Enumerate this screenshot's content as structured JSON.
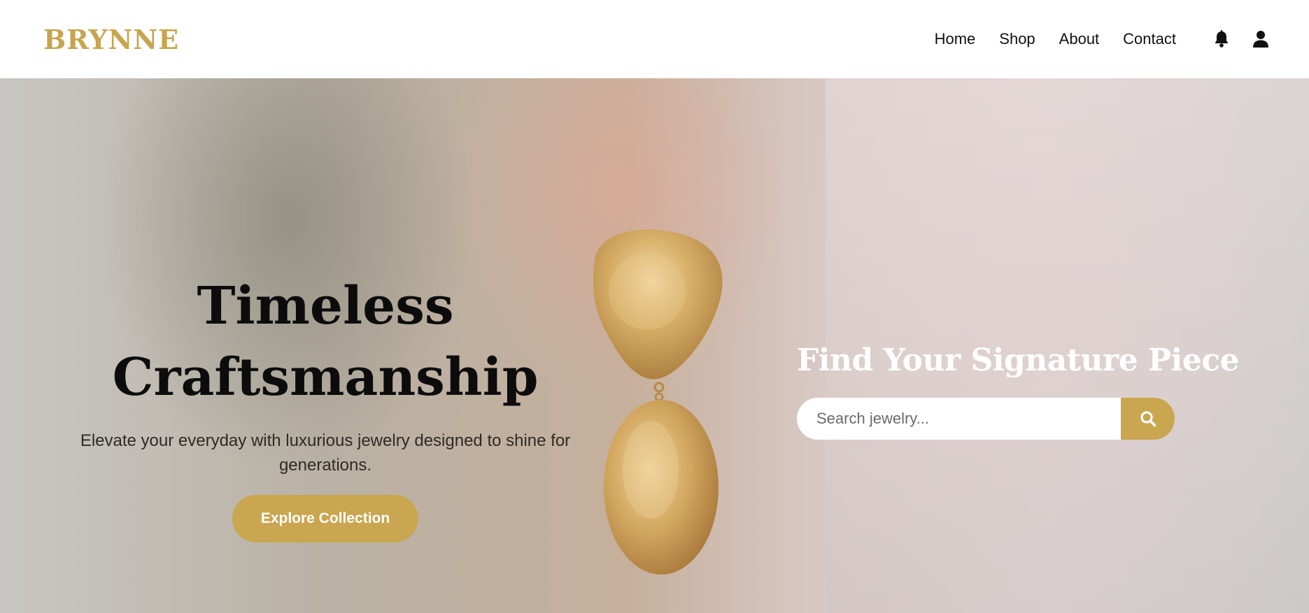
{
  "brand": {
    "logo": "BRYNNE",
    "accent_color": "#c9a64f"
  },
  "nav": {
    "items": [
      {
        "label": "Home"
      },
      {
        "label": "Shop"
      },
      {
        "label": "About"
      },
      {
        "label": "Contact"
      }
    ],
    "icons": [
      "bell-icon",
      "user-icon"
    ]
  },
  "hero": {
    "title_line1": "Timeless",
    "title_line2": "Craftsmanship",
    "subtitle": "Elevate your everyday with luxurious jewelry designed to shine for generations.",
    "cta_label": "Explore Collection"
  },
  "search": {
    "heading": "Find Your Signature Piece",
    "placeholder": "Search jewelry...",
    "button_icon": "search-icon"
  }
}
